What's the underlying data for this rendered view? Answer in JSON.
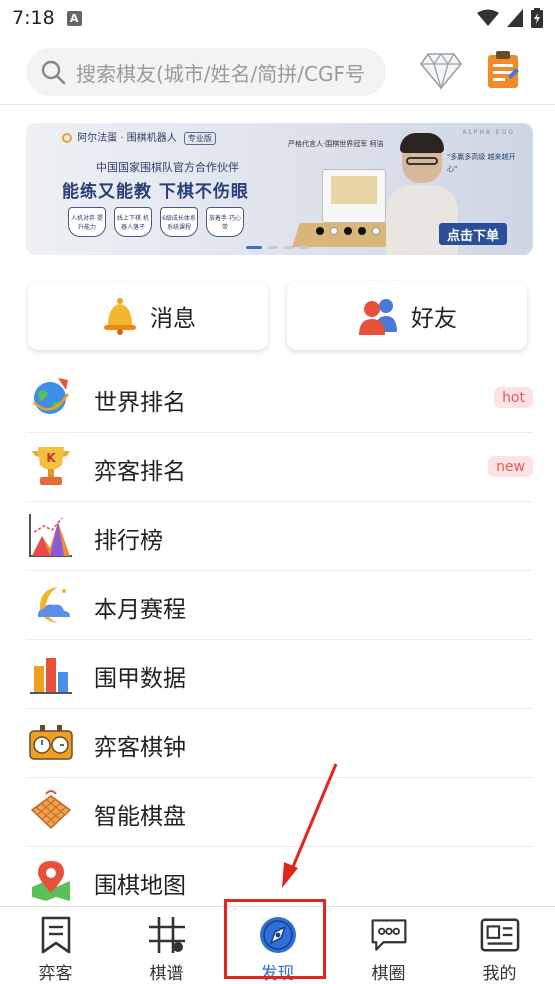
{
  "status_bar": {
    "time": "7:18",
    "notification_badge": "A"
  },
  "search": {
    "placeholder": "搜索棋友(城市/姓名/简拼/CGF号"
  },
  "banner": {
    "brand": "阿尔法蛋 · 围棋机器人",
    "brand_sub": "ALPHA EGG",
    "brand_tag": "专业版",
    "sub_headline": "中国国家围棋队官方合作伙伴",
    "headline": "能练又能教  下棋不伤眼",
    "badges": [
      "人机对弈 提升能力",
      "线上下棋 机器人落子",
      "6级成长体系 系统课程",
      "放着手 巧心带"
    ],
    "right_note": "严格代言人·围棋世界冠军 柯洁",
    "quote": "\"多赢多高级 越来越开心\"",
    "alpha": "ALPHA EGG",
    "cta": "点击下单",
    "active_dot": 0,
    "dot_count": 4
  },
  "cards": {
    "messages": "消息",
    "friends": "好友"
  },
  "menu": [
    {
      "label": "世界排名",
      "icon": "globe-rocket-icon",
      "badge": "hot"
    },
    {
      "label": "弈客排名",
      "icon": "trophy-icon",
      "badge": "new"
    },
    {
      "label": "排行榜",
      "icon": "mountain-chart-icon",
      "badge": ""
    },
    {
      "label": "本月赛程",
      "icon": "moon-cloud-icon",
      "badge": ""
    },
    {
      "label": "围甲数据",
      "icon": "bar-chart-icon",
      "badge": ""
    },
    {
      "label": "弈客棋钟",
      "icon": "chess-clock-icon",
      "badge": ""
    },
    {
      "label": "智能棋盘",
      "icon": "smart-board-icon",
      "badge": ""
    },
    {
      "label": "围棋地图",
      "icon": "map-pin-icon",
      "badge": ""
    }
  ],
  "tabs": [
    {
      "label": "弈客",
      "icon": "bookmark-icon",
      "active": false
    },
    {
      "label": "棋谱",
      "icon": "grid-board-icon",
      "active": false
    },
    {
      "label": "发现",
      "icon": "compass-icon",
      "active": true
    },
    {
      "label": "棋圈",
      "icon": "chat-bubble-icon",
      "active": false
    },
    {
      "label": "我的",
      "icon": "profile-card-icon",
      "active": false
    }
  ],
  "colors": {
    "accent_blue": "#2f6fd8",
    "highlight_red": "#e2261f",
    "pill_bg": "#fde3e3",
    "pill_text": "#e05a5a"
  }
}
